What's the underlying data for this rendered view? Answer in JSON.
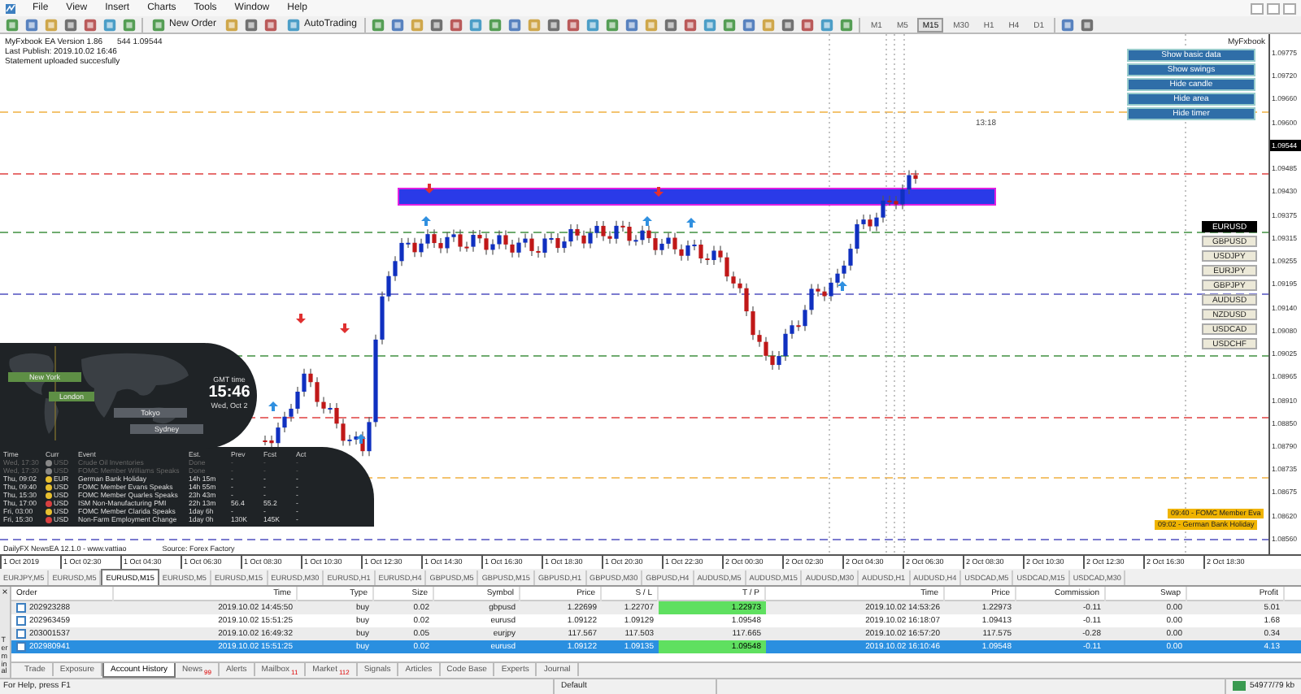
{
  "menu": [
    "File",
    "View",
    "Insert",
    "Charts",
    "Tools",
    "Window",
    "Help"
  ],
  "toolbar": {
    "new_order": "New Order",
    "autotrading": "AutoTrading",
    "timeframes": [
      {
        "label": "M1",
        "selected": false
      },
      {
        "label": "M5",
        "selected": false
      },
      {
        "label": "M15",
        "selected": true
      },
      {
        "label": "M30",
        "selected": false
      },
      {
        "label": "H1",
        "selected": false
      },
      {
        "label": "H4",
        "selected": false
      },
      {
        "label": "D1",
        "selected": false
      }
    ]
  },
  "chart": {
    "price_info": "544 1.09544",
    "ea_info": [
      "MyFxbook EA Version 1.86",
      "Last Publish: 2019.10.02 16:46",
      "Statement uploaded succesfully"
    ],
    "panel_title": "MyFxbook",
    "panel_buttons": [
      "Show basic data",
      "Show swings",
      "Hide candle",
      "Hide area",
      "Hide timer"
    ],
    "symbols": [
      {
        "label": "EURUSD",
        "selected": true
      },
      {
        "label": "GBPUSD",
        "selected": false
      },
      {
        "label": "USDJPY",
        "selected": false
      },
      {
        "label": "EURJPY",
        "selected": false
      },
      {
        "label": "GBPJPY",
        "selected": false
      },
      {
        "label": "AUDUSD",
        "selected": false
      },
      {
        "label": "NZDUSD",
        "selected": false
      },
      {
        "label": "USDCAD",
        "selected": false
      },
      {
        "label": "USDCHF",
        "selected": false
      }
    ],
    "timer": "13:18",
    "news_labels": [
      "09:40 - FOMC Member Eva",
      "09:02 - German Bank Holiday"
    ],
    "price_axis": [
      {
        "label": "1.09775",
        "current": false
      },
      {
        "label": "1.09720",
        "current": false
      },
      {
        "label": "1.09660",
        "current": false
      },
      {
        "label": "1.09600",
        "current": false
      },
      {
        "label": "1.09544",
        "current": true
      },
      {
        "label": "1.09485",
        "current": false
      },
      {
        "label": "1.09430",
        "current": false
      },
      {
        "label": "1.09375",
        "current": false
      },
      {
        "label": "1.09315",
        "current": false
      },
      {
        "label": "1.09255",
        "current": false
      },
      {
        "label": "1.09195",
        "current": false
      },
      {
        "label": "1.09140",
        "current": false
      },
      {
        "label": "1.09080",
        "current": false
      },
      {
        "label": "1.09025",
        "current": false
      },
      {
        "label": "1.08965",
        "current": false
      },
      {
        "label": "1.08910",
        "current": false
      },
      {
        "label": "1.08850",
        "current": false
      },
      {
        "label": "1.08790",
        "current": false
      },
      {
        "label": "1.08735",
        "current": false
      },
      {
        "label": "1.08675",
        "current": false
      },
      {
        "label": "1.08620",
        "current": false
      },
      {
        "label": "1.08560",
        "current": false
      }
    ],
    "time_axis": [
      "1 Oct 2019",
      "1 Oct 02:30",
      "1 Oct 04:30",
      "1 Oct 06:30",
      "1 Oct 08:30",
      "1 Oct 10:30",
      "1 Oct 12:30",
      "1 Oct 14:30",
      "1 Oct 16:30",
      "1 Oct 18:30",
      "1 Oct 20:30",
      "1 Oct 22:30",
      "2 Oct 00:30",
      "2 Oct 02:30",
      "2 Oct 04:30",
      "2 Oct 06:30",
      "2 Oct 08:30",
      "2 Oct 10:30",
      "2 Oct 12:30",
      "2 Oct 16:30",
      "2 Oct 18:30"
    ],
    "news_widget": {
      "sessions": [
        {
          "label": "New York",
          "color": "#5e8f45"
        },
        {
          "label": "London",
          "color": "#5e8f45"
        },
        {
          "label": "Tokyo",
          "color": "#5a5f66"
        },
        {
          "label": "Sydney",
          "color": "#5a5f66"
        }
      ],
      "clock_label": "GMT time",
      "clock": "15:46",
      "date": "Wed, Oct 2",
      "columns": [
        "Time",
        "Curr",
        "Event",
        "Est.",
        "Prev",
        "Fcst",
        "Act"
      ],
      "events": [
        {
          "time": "Wed, 17:30",
          "currency": "USD",
          "color": "#888888",
          "event": "Crude Oil Inventories",
          "eta": "Done",
          "prev": "-",
          "fcst": "-",
          "act": "-",
          "past": true
        },
        {
          "time": "Wed, 17:30",
          "currency": "USD",
          "color": "#888888",
          "event": "FOMC Member Williams Speaks",
          "eta": "Done",
          "prev": "-",
          "fcst": "-",
          "act": "-",
          "past": true
        },
        {
          "time": "Thu, 09:02",
          "currency": "EUR",
          "color": "#e8c030",
          "event": "German Bank Holiday",
          "eta": "14h 15m",
          "prev": "-",
          "fcst": "-",
          "act": "-",
          "past": false
        },
        {
          "time": "Thu, 09:40",
          "currency": "USD",
          "color": "#e8c030",
          "event": "FOMC Member Evans Speaks",
          "eta": "14h 55m",
          "prev": "-",
          "fcst": "-",
          "act": "-",
          "past": false
        },
        {
          "time": "Thu, 15:30",
          "currency": "USD",
          "color": "#e8c030",
          "event": "FOMC Member Quarles Speaks",
          "eta": "23h 43m",
          "prev": "-",
          "fcst": "-",
          "act": "-",
          "past": false
        },
        {
          "time": "Thu, 17:00",
          "currency": "USD",
          "color": "#d84040",
          "event": "ISM Non-Manufacturing PMI",
          "eta": "22h 13m",
          "prev": "56.4",
          "fcst": "55.2",
          "act": "-",
          "past": false
        },
        {
          "time": "Fri, 03:00",
          "currency": "USD",
          "color": "#e8c030",
          "event": "FOMC Member Clarida Speaks",
          "eta": "1day 6h",
          "prev": "-",
          "fcst": "-",
          "act": "-",
          "past": false
        },
        {
          "time": "Fri, 15:30",
          "currency": "USD",
          "color": "#d84040",
          "event": "Non-Farm Employment Change",
          "eta": "1day 0h",
          "prev": "130K",
          "fcst": "145K",
          "act": "-",
          "past": false
        }
      ],
      "footer": [
        "DailyFX NewsEA 12.1.0 - www.vattiao",
        "Source: Forex Factory"
      ]
    }
  },
  "chart_tabs": [
    {
      "label": "EURJPY,M5",
      "selected": false
    },
    {
      "label": "EURUSD,M5",
      "selected": false
    },
    {
      "label": "EURUSD,M15",
      "selected": true
    },
    {
      "label": "EURUSD,M5",
      "selected": false
    },
    {
      "label": "EURUSD,M15",
      "selected": false
    },
    {
      "label": "EURUSD,M30",
      "selected": false
    },
    {
      "label": "EURUSD,H1",
      "selected": false
    },
    {
      "label": "EURUSD,H4",
      "selected": false
    },
    {
      "label": "GBPUSD,M5",
      "selected": false
    },
    {
      "label": "GBPUSD,M15",
      "selected": false
    },
    {
      "label": "GBPUSD,H1",
      "selected": false
    },
    {
      "label": "GBPUSD,M30",
      "selected": false
    },
    {
      "label": "GBPUSD,H4",
      "selected": false
    },
    {
      "label": "AUDUSD,M5",
      "selected": false
    },
    {
      "label": "AUDUSD,M15",
      "selected": false
    },
    {
      "label": "AUDUSD,M30",
      "selected": false
    },
    {
      "label": "AUDUSD,H1",
      "selected": false
    },
    {
      "label": "AUDUSD,H4",
      "selected": false
    },
    {
      "label": "USDCAD,M5",
      "selected": false
    },
    {
      "label": "USDCAD,M15",
      "selected": false
    },
    {
      "label": "USDCAD,M30",
      "selected": false
    }
  ],
  "terminal": {
    "title": "Terminal",
    "close_icon": "×",
    "columns": [
      "Order",
      "Time",
      "Type",
      "Size",
      "Symbol",
      "Price",
      "S / L",
      "T / P",
      "Time",
      "Price",
      "Commission",
      "Swap",
      "Profit"
    ],
    "rows": [
      {
        "cells": [
          "202923288",
          "2019.10.02 14:45:50",
          "buy",
          "0.02",
          "gbpusd",
          "1.22699",
          "1.22707",
          "1.22973",
          "2019.10.02 14:53:26",
          "1.22973",
          "-0.11",
          "0.00",
          "5.01"
        ],
        "selected": false,
        "tp_hit": true
      },
      {
        "cells": [
          "202963459",
          "2019.10.02 15:51:25",
          "buy",
          "0.02",
          "eurusd",
          "1.09122",
          "1.09129",
          "1.09548",
          "2019.10.02 16:18:07",
          "1.09413",
          "-0.11",
          "0.00",
          "1.68"
        ],
        "selected": false,
        "tp_hit": false
      },
      {
        "cells": [
          "203001537",
          "2019.10.02 16:49:32",
          "buy",
          "0.05",
          "eurjpy",
          "117.567",
          "117.503",
          "117.665",
          "2019.10.02 16:57:20",
          "117.575",
          "-0.28",
          "0.00",
          "0.34"
        ],
        "selected": false,
        "tp_hit": false
      },
      {
        "cells": [
          "202980941",
          "2019.10.02 15:51:25",
          "buy",
          "0.02",
          "eurusd",
          "1.09122",
          "1.09135",
          "1.09548",
          "2019.10.02 16:10:46",
          "1.09548",
          "-0.11",
          "0.00",
          "4.13"
        ],
        "selected": true,
        "tp_hit": true
      }
    ],
    "tabs": [
      {
        "label": "Trade",
        "selected": false
      },
      {
        "label": "Exposure",
        "selected": false
      },
      {
        "label": "Account History",
        "selected": true
      },
      {
        "label": "News",
        "badge": "99",
        "selected": false
      },
      {
        "label": "Alerts",
        "selected": false
      },
      {
        "label": "Mailbox",
        "badge": "11",
        "selected": false
      },
      {
        "label": "Market",
        "badge": "112",
        "selected": false
      },
      {
        "label": "Signals",
        "selected": false
      },
      {
        "label": "Articles",
        "selected": false
      },
      {
        "label": "Code Base",
        "selected": false
      },
      {
        "label": "Experts",
        "selected": false
      },
      {
        "label": "Journal",
        "selected": false
      }
    ]
  },
  "status_bar": {
    "help": "For Help, press F1",
    "profile": "Default",
    "traffic": "54977/79 kb"
  }
}
